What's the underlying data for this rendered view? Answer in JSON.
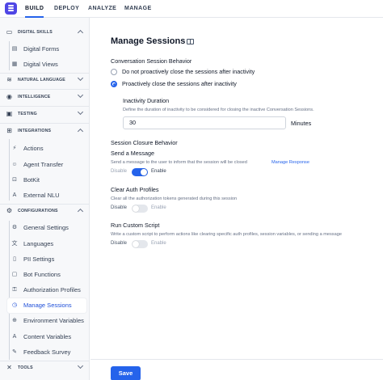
{
  "topnav": {
    "tabs": [
      {
        "label": "BUILD",
        "active": true
      },
      {
        "label": "DEPLOY",
        "active": false
      },
      {
        "label": "ANALYZE",
        "active": false
      },
      {
        "label": "MANAGE",
        "active": false
      }
    ]
  },
  "sidebar": {
    "groups": [
      {
        "label": "DIGITAL SKILLS",
        "icon": "monitor-icon",
        "expanded": true,
        "items": [
          {
            "label": "Digital Forms",
            "icon": "form-icon"
          },
          {
            "label": "Digital Views",
            "icon": "view-icon"
          }
        ]
      },
      {
        "label": "NATURAL LANGUAGE",
        "icon": "language-icon",
        "expanded": false,
        "items": []
      },
      {
        "label": "INTELLIGENCE",
        "icon": "intelligence-icon",
        "expanded": false,
        "items": []
      },
      {
        "label": "TESTING",
        "icon": "testing-icon",
        "expanded": false,
        "items": []
      },
      {
        "label": "INTEGRATIONS",
        "icon": "integrations-icon",
        "expanded": true,
        "items": [
          {
            "label": "Actions",
            "icon": "actions-icon"
          },
          {
            "label": "Agent Transfer",
            "icon": "agent-transfer-icon"
          },
          {
            "label": "BotKit",
            "icon": "botkit-icon"
          },
          {
            "label": "External NLU",
            "icon": "external-nlu-icon"
          }
        ]
      },
      {
        "label": "CONFIGURATIONS",
        "icon": "configurations-icon",
        "expanded": true,
        "items": [
          {
            "label": "General Settings",
            "icon": "gear-icon"
          },
          {
            "label": "Languages",
            "icon": "languages-icon"
          },
          {
            "label": "PII Settings",
            "icon": "pii-icon"
          },
          {
            "label": "Bot Functions",
            "icon": "bot-functions-icon"
          },
          {
            "label": "Authorization Profiles",
            "icon": "authorization-icon"
          },
          {
            "label": "Manage Sessions",
            "icon": "sessions-icon",
            "active": true
          },
          {
            "label": "Environment Variables",
            "icon": "environment-icon"
          },
          {
            "label": "Content Variables",
            "icon": "content-variables-icon"
          },
          {
            "label": "Feedback Survey",
            "icon": "feedback-icon"
          }
        ]
      },
      {
        "label": "TOOLS",
        "icon": "tools-icon",
        "expanded": false,
        "items": []
      }
    ]
  },
  "main": {
    "title": "Manage Sessions",
    "behavior": {
      "heading": "Conversation Session Behavior",
      "options": [
        {
          "label": "Do not proactively close the sessions after inactivity",
          "checked": false
        },
        {
          "label": "Proactively close the sessions after inactivity",
          "checked": true
        }
      ]
    },
    "inactivity": {
      "label": "Inactivity Duration",
      "description": "Define the duration of inactivity to be considered for closing the inactive Conversation Sessions.",
      "value": "30",
      "unit": "Minutes"
    },
    "closure": {
      "heading": "Session Closure Behavior",
      "send_message": {
        "label": "Send a Message",
        "description": "Send a message to the user to inform that the session will be closed",
        "link": "Manage Response",
        "off_label": "Disable",
        "on_label": "Enable",
        "enabled": true
      },
      "clear_auth": {
        "label": "Clear Auth Profiles",
        "description": "Clear all the authorization tokens generated during this session",
        "off_label": "Disable",
        "on_label": "Enable",
        "enabled": false
      },
      "custom_script": {
        "label": "Run Custom Script",
        "description": "Write a custom script to perform actions like clearing specific auth profiles, session variables, or sending a message",
        "off_label": "Disable",
        "on_label": "Enable",
        "enabled": false
      }
    }
  },
  "footer": {
    "save_label": "Save"
  },
  "colors": {
    "accent": "#2563eb",
    "sidebar_bg": "#f7f8fa",
    "logo": "#4f46e5"
  }
}
